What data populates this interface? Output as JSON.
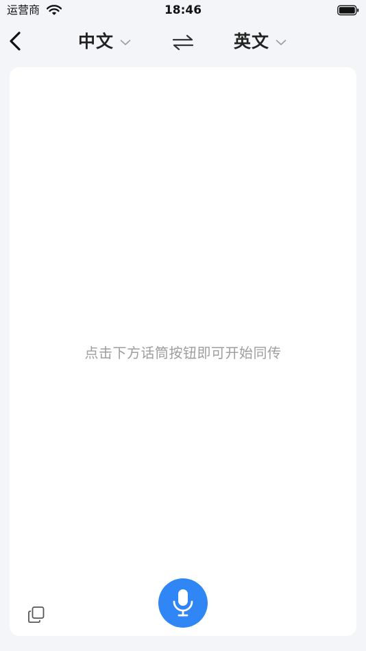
{
  "status_bar": {
    "carrier": "运营商",
    "time": "18:46"
  },
  "nav": {
    "source_language": "中文",
    "target_language": "英文"
  },
  "main": {
    "hint": "点击下方话筒按钮即可开始同传"
  },
  "colors": {
    "background": "#f4f5f9",
    "card": "#ffffff",
    "accent": "#2f86f4",
    "hint_text": "#9d9d9d"
  },
  "icons": {
    "back": "chevron-left-icon",
    "dropdown": "chevron-down-icon",
    "swap": "swap-arrows-icon",
    "copy": "copy-icon",
    "mic": "microphone-icon",
    "wifi": "wifi-icon",
    "battery": "battery-icon"
  }
}
